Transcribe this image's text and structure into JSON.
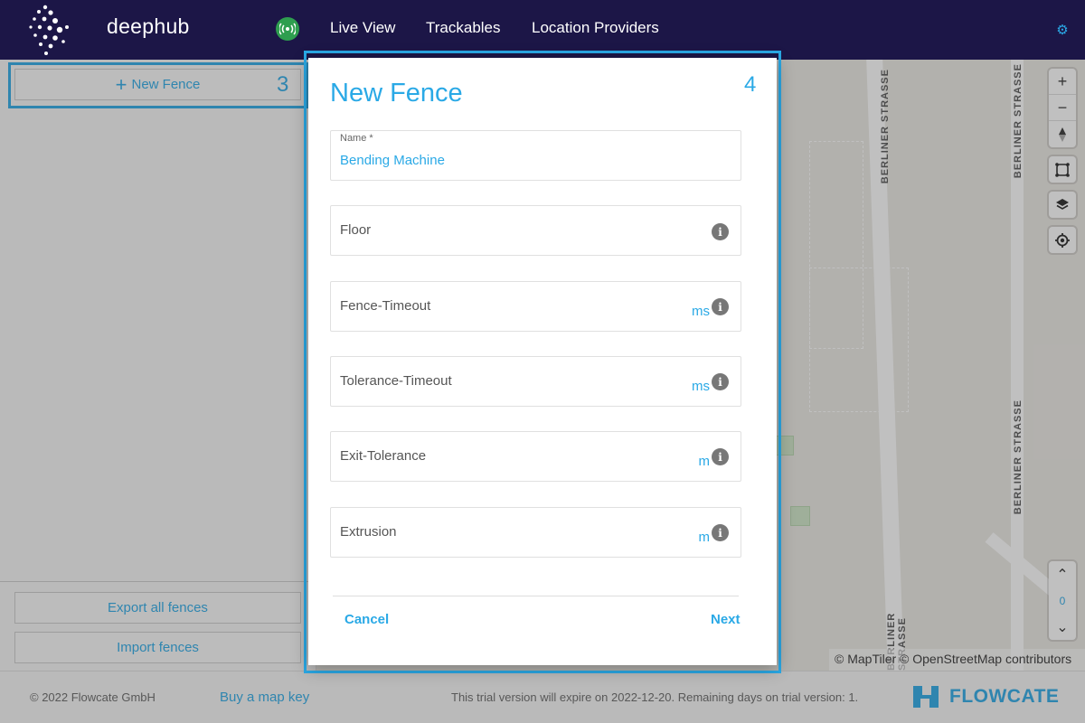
{
  "header": {
    "brand": "deephub",
    "nav": [
      "Live View",
      "Trackables",
      "Location Providers"
    ],
    "icons": {
      "status": "broadcast-icon",
      "settings": "gear-icon"
    }
  },
  "sidebar": {
    "new_fence": "New Fence",
    "export": "Export all fences",
    "import": "Import fences"
  },
  "annotations": {
    "left": "3",
    "dialog": "4"
  },
  "map": {
    "street_name": "BERLINER STRASSE",
    "attribution": "© MapTiler © OpenStreetMap contributors",
    "floor_level": "0"
  },
  "dialog": {
    "title": "New Fence",
    "fields": [
      {
        "label": "Name *",
        "value": "Bending Machine"
      },
      {
        "label": "Floor",
        "unit": ""
      },
      {
        "label": "Fence-Timeout",
        "unit": "ms"
      },
      {
        "label": "Tolerance-Timeout",
        "unit": "ms"
      },
      {
        "label": "Exit-Tolerance",
        "unit": "m"
      },
      {
        "label": "Extrusion",
        "unit": "m"
      }
    ],
    "cancel": "Cancel",
    "next": "Next"
  },
  "footer": {
    "copyright": "© 2022 Flowcate GmbH",
    "buy_key": "Buy a map key",
    "trial": "This trial version will expire on 2022-12-20. Remaining days on trial version: 1.",
    "company": "FLOWCATE"
  },
  "colors": {
    "accent": "#2aa9e6",
    "navbar": "#1c1647",
    "status_ok": "#2e9e4f"
  }
}
